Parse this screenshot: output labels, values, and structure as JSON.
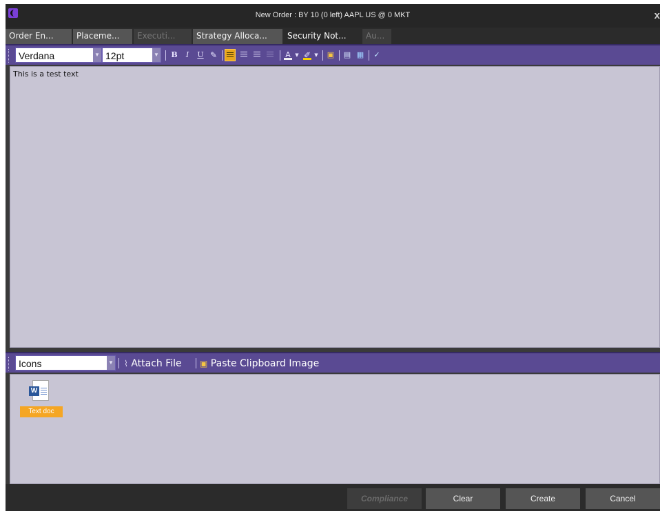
{
  "window": {
    "title": "New Order : BY 10 (0 left) AAPL US @ 0 MKT",
    "close_label": "x"
  },
  "tabs": [
    {
      "label": "Order En...",
      "state": "normal"
    },
    {
      "label": "Placeme...",
      "state": "normal"
    },
    {
      "label": "Executi...",
      "state": "disabled"
    },
    {
      "label": "Strategy Alloca...",
      "state": "normal"
    },
    {
      "label": "Security Not...",
      "state": "active"
    },
    {
      "label": "Au...",
      "state": "disabled"
    }
  ],
  "toolbar": {
    "font_family": "Verdana",
    "font_size": "12pt",
    "bold_label": "B",
    "italic_label": "I",
    "underline_label": "U",
    "active_alignment": "left",
    "font_color": "#f0f0f0",
    "highlight_color": "#f5d000",
    "selected_color": "#e8a51c",
    "bar_color": "#5a4a93"
  },
  "editor": {
    "text": "This is a test text"
  },
  "attachments": {
    "view_mode": "Icons",
    "attach_file_label": "Attach File",
    "paste_image_label": "Paste Clipboard Image",
    "items": [
      {
        "name": "Text doc",
        "icon": "word-doc-icon"
      }
    ]
  },
  "footer": {
    "compliance_label": "Compliance",
    "clear_label": "Clear",
    "create_label": "Create",
    "cancel_label": "Cancel"
  }
}
